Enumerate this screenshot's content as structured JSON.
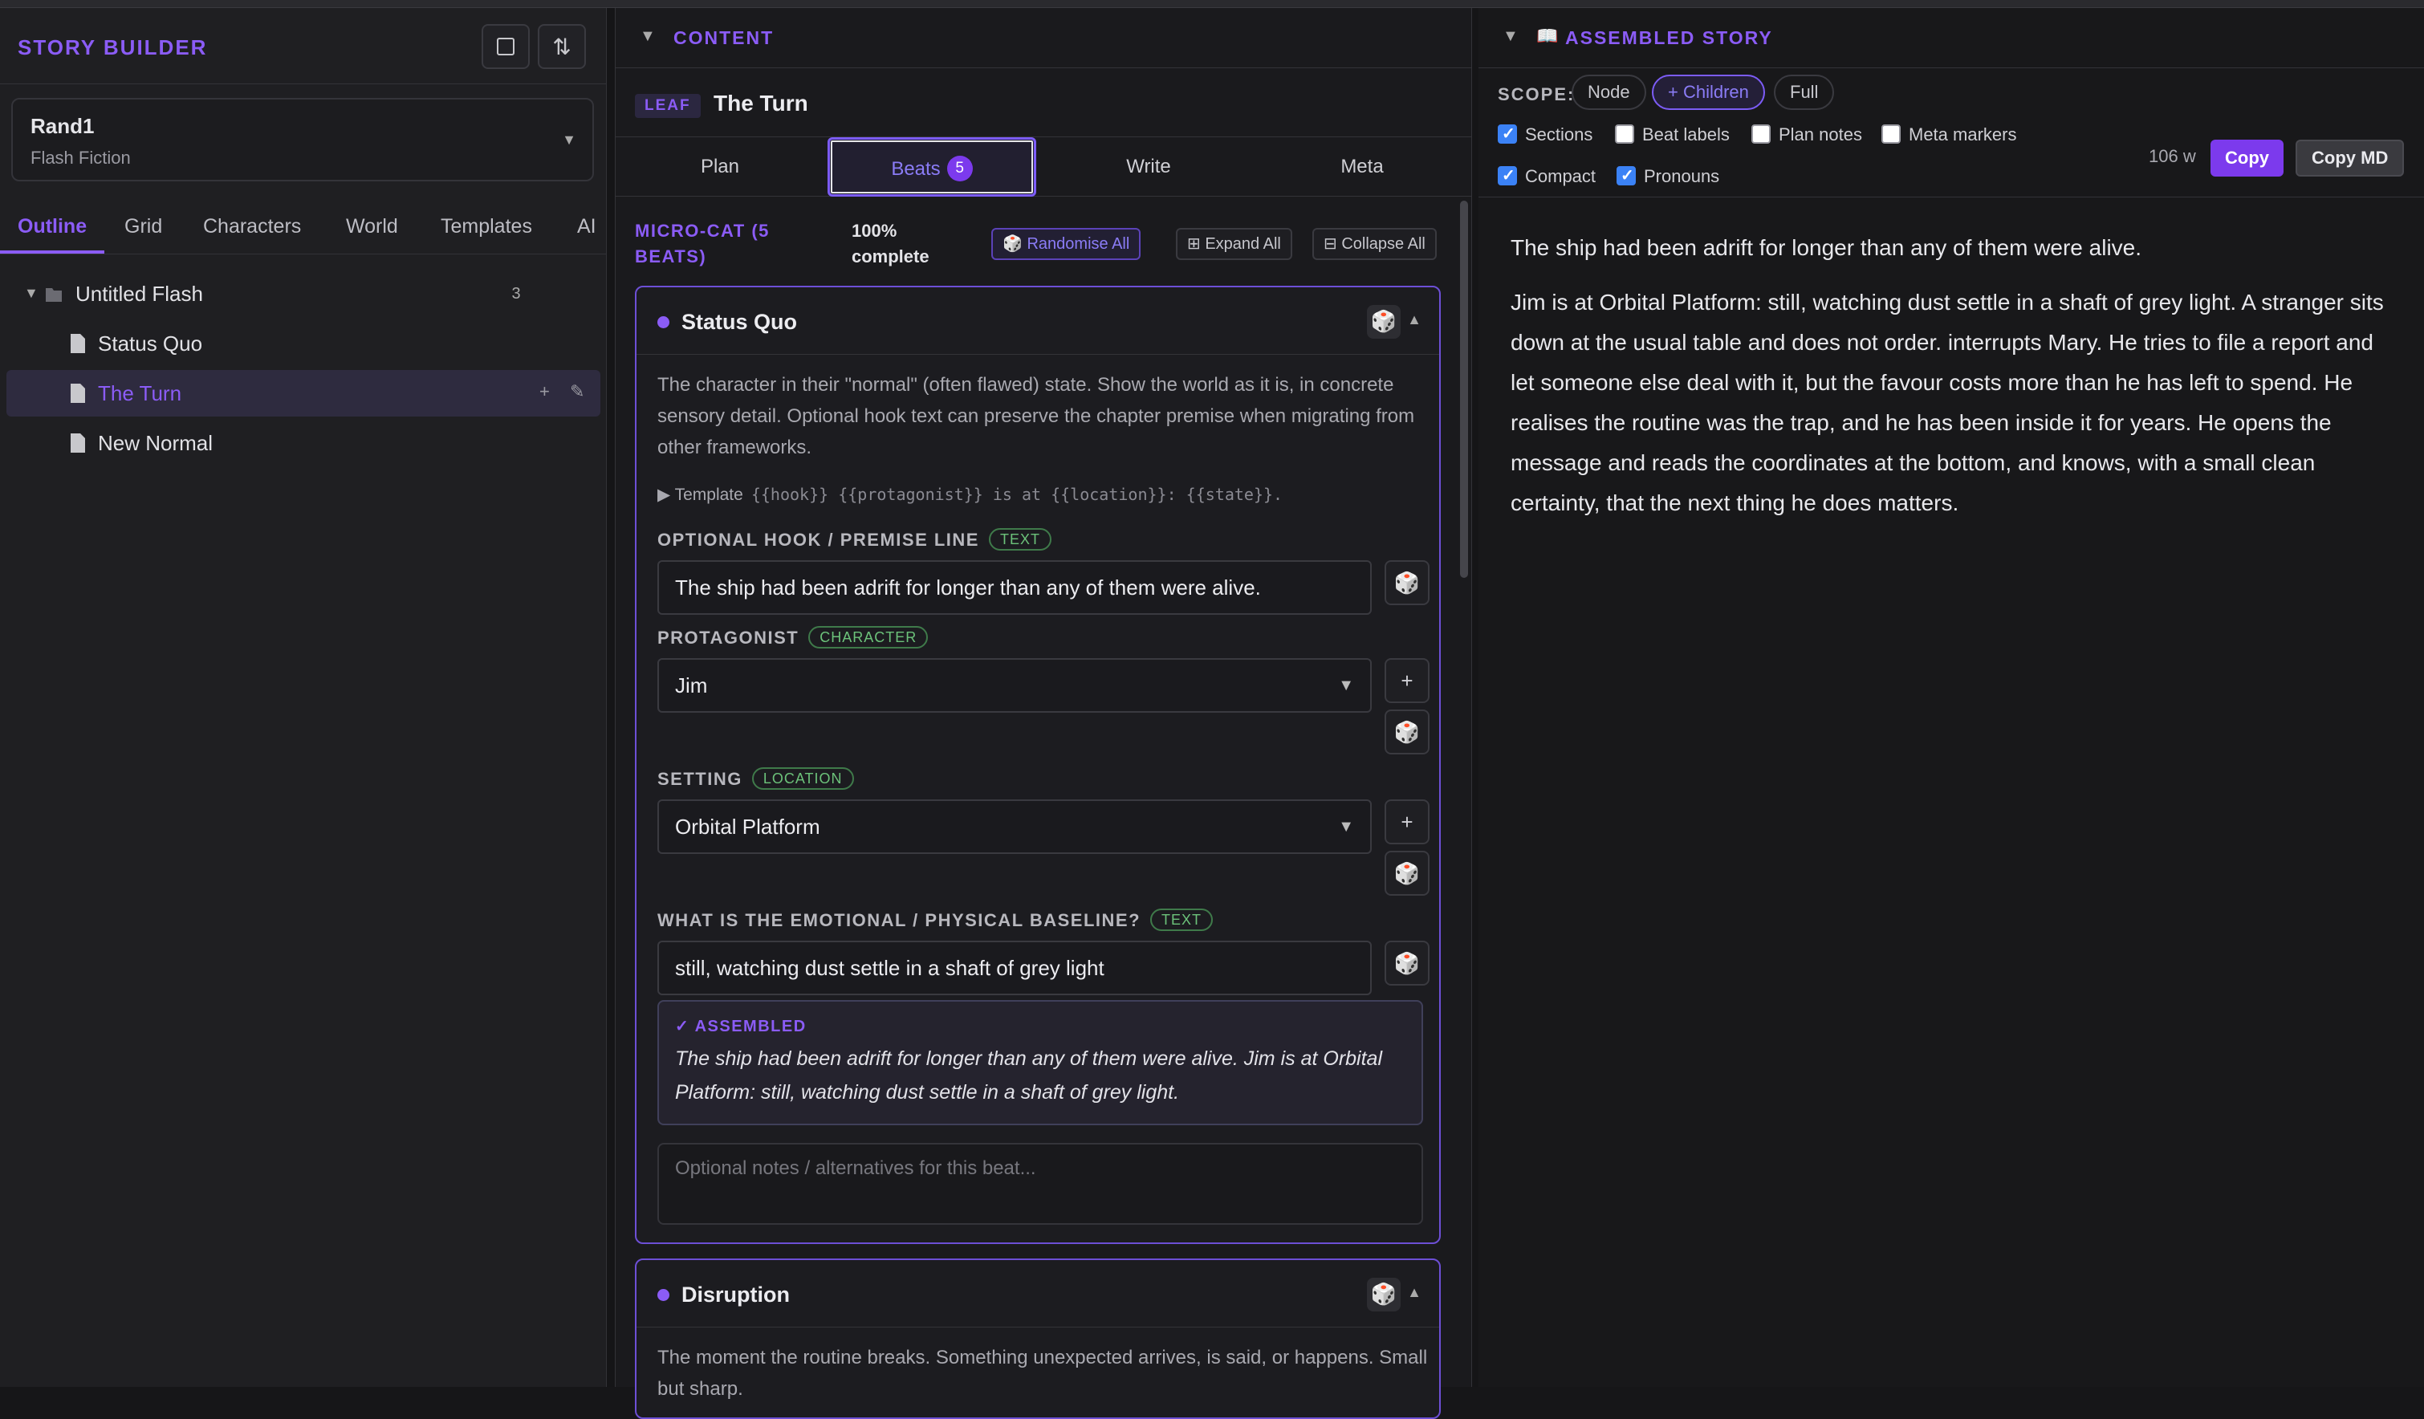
{
  "sidebar": {
    "title": "STORY BUILDER",
    "project": {
      "name": "Rand1",
      "type": "Flash Fiction"
    },
    "tabs": [
      "Outline",
      "Grid",
      "Characters",
      "World",
      "Templates",
      "AI"
    ],
    "tree": {
      "root_label": "Untitled Flash",
      "root_count": "3",
      "children": [
        "Status Quo",
        "The Turn",
        "New Normal"
      ]
    },
    "icons": {
      "layout": "panel-icon",
      "sort": "swap-vertical-icon"
    }
  },
  "content": {
    "section_title": "CONTENT",
    "leaf_badge": "LEAF",
    "leaf_name": "The Turn",
    "tabs": {
      "plan": "Plan",
      "beats": "Beats",
      "beats_count": "5",
      "write": "Write",
      "meta": "Meta"
    },
    "category": {
      "title": "MICRO-CAT (5 BEATS)",
      "progress": "100% complete",
      "randomise": "Randomise All",
      "expand": "Expand All",
      "collapse": "Collapse All"
    },
    "beat1": {
      "title": "Status Quo",
      "description": "The character in their \"normal\" (often flawed) state. Show the world as it is, in concrete sensory detail. Optional hook text can preserve the chapter premise when migrating from other frameworks.",
      "template_label": "Template",
      "template_code": "{{hook}} {{protagonist}} is at {{location}}: {{state}}.",
      "fields": {
        "hook_label": "OPTIONAL HOOK / PREMISE LINE",
        "hook_chip": "TEXT",
        "hook_value": "The ship had been adrift for longer than any of them were alive.",
        "protagonist_label": "PROTAGONIST",
        "protagonist_chip": "CHARACTER",
        "protagonist_value": "Jim",
        "setting_label": "SETTING",
        "setting_chip": "LOCATION",
        "setting_value": "Orbital Platform",
        "state_label": "WHAT IS THE EMOTIONAL / PHYSICAL BASELINE?",
        "state_chip": "TEXT",
        "state_value": "still, watching dust settle in a shaft of grey light"
      },
      "assembled_label": "✓ ASSEMBLED",
      "assembled_text": "The ship had been adrift for longer than any of them were alive. Jim is at Orbital Platform: still, watching dust settle in a shaft of grey light.",
      "notes_placeholder": "Optional notes / alternatives for this beat..."
    },
    "beat2": {
      "title": "Disruption",
      "description": "The moment the routine breaks. Something unexpected arrives, is said, or happens. Small but sharp."
    }
  },
  "assembled_story": {
    "section_title": "ASSEMBLED STORY",
    "scope_label": "SCOPE:",
    "scope_options": [
      "Node",
      "+ Children",
      "Full"
    ],
    "options": {
      "sections": "Sections",
      "beat_labels": "Beat labels",
      "plan_notes": "Plan notes",
      "meta_markers": "Meta markers",
      "compact": "Compact",
      "pronouns": "Pronouns"
    },
    "word_count": "106 w",
    "copy": "Copy",
    "copy_md": "Copy MD",
    "paragraphs": [
      "The ship had been adrift for longer than any of them were alive.",
      "Jim is at Orbital Platform: still, watching dust settle in a shaft of grey light. A stranger sits down at the usual table and does not order. interrupts Mary. He tries to file a report and let someone else deal with it, but the favour costs more than he has left to spend. He realises the routine was the trap, and he has been inside it for years. He opens the message and reads the coordinates at the bottom, and knows, with a small clean certainty, that the next thing he does matters."
    ]
  },
  "colors": {
    "accent": "#8b5cf6",
    "checkbox": "#3b82f6",
    "chip_green": "#6cc27a"
  }
}
